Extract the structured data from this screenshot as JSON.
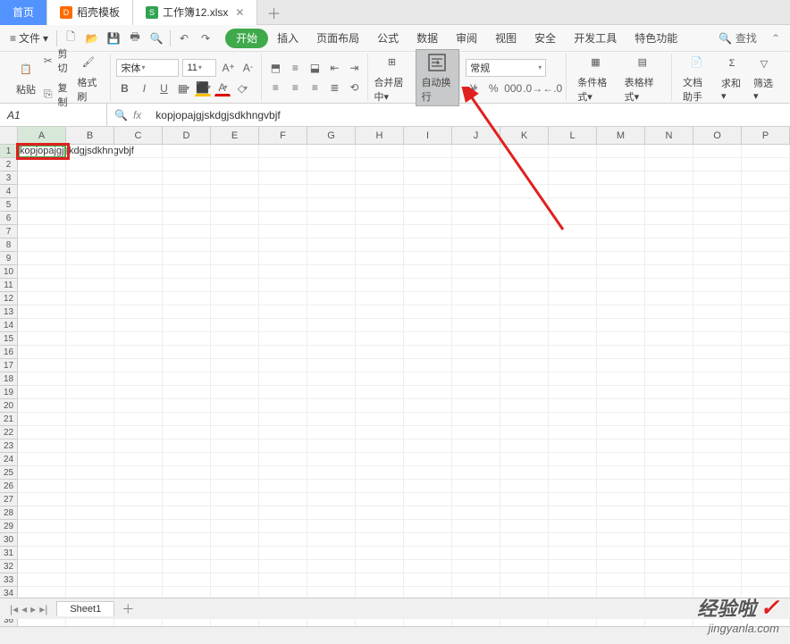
{
  "top_tabs": {
    "home": "首页",
    "template": "稻壳模板",
    "workbook": "工作簿12.xlsx"
  },
  "menu": {
    "file": "文件",
    "search": "查找"
  },
  "ribbon": {
    "tabs": {
      "start": "开始",
      "insert": "插入",
      "layout": "页面布局",
      "formula": "公式",
      "data": "数据",
      "review": "审阅",
      "view": "视图",
      "security": "安全",
      "devtools": "开发工具",
      "special": "特色功能"
    },
    "clipboard": {
      "paste": "粘贴",
      "cut": "剪切",
      "copy": "复制",
      "format_painter": "格式刷"
    },
    "font": {
      "family": "宋体",
      "size": "11",
      "bold": "B",
      "italic": "I",
      "underline": "U"
    },
    "align": {
      "merge": "合并居中",
      "wrap": "自动换行"
    },
    "number": {
      "format": "常规"
    },
    "styles": {
      "cond": "条件格式",
      "table": "表格样式"
    },
    "tools": {
      "doc_assist": "文档助手",
      "sum": "求和",
      "filter": "筛选"
    }
  },
  "formula_bar": {
    "name_box": "A1",
    "fx": "fx",
    "value": "kopjopajgjskdgjsdkhngvbjf"
  },
  "grid": {
    "columns": [
      "A",
      "B",
      "C",
      "D",
      "E",
      "F",
      "G",
      "H",
      "I",
      "J",
      "K",
      "L",
      "M",
      "N",
      "O",
      "P"
    ],
    "cell_a1": "kopjopajgjskdgjsdkhngvbjf"
  },
  "sheet_tabs": {
    "sheet1": "Sheet1"
  },
  "watermark": {
    "brand": "经验啦",
    "url": "jingyanla.com"
  }
}
